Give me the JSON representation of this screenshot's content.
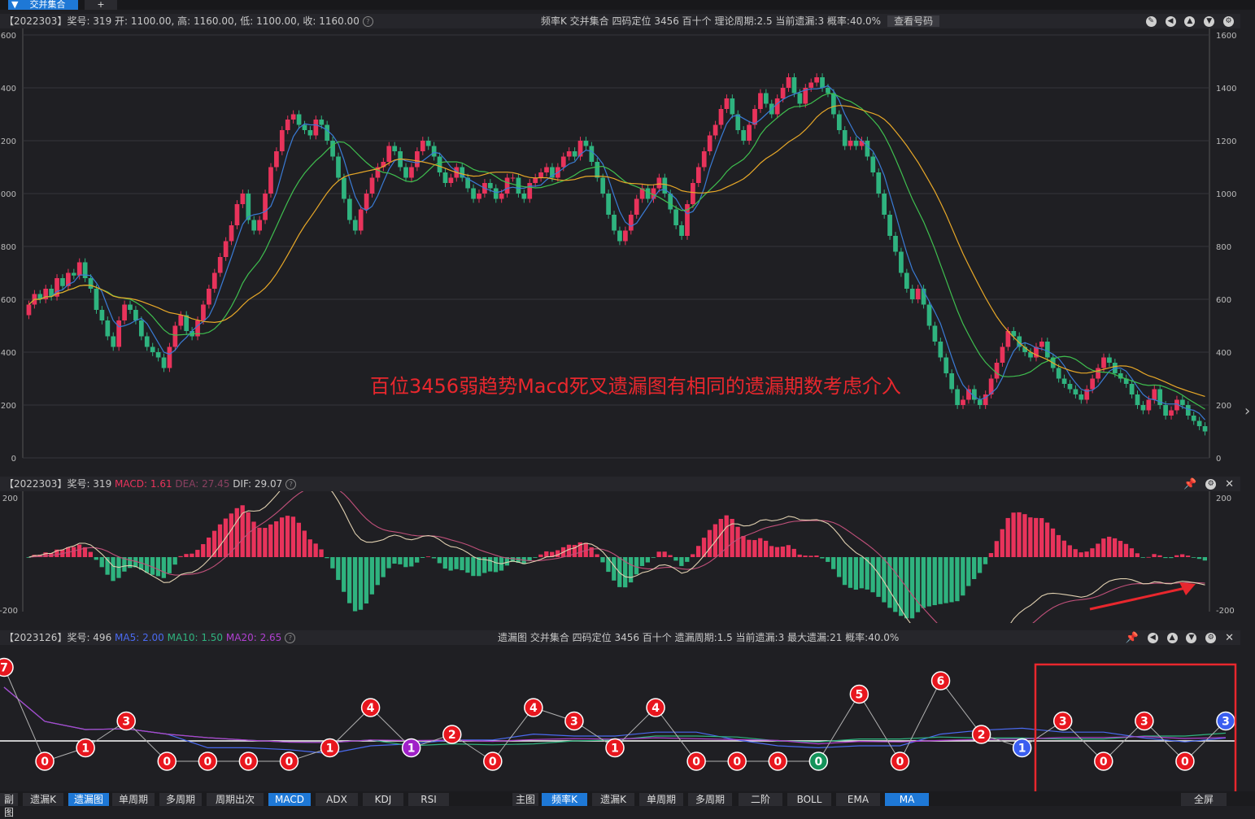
{
  "tabs": {
    "main_label": "交并集合",
    "plus": "+"
  },
  "kline": {
    "header_left": "【2022303】奖号: 319  开: 1100.00, 高: 1160.00, 低: 1100.00, 收: 1160.00",
    "header_center": "频率K  交并集合  四码定位 3456  百十个  理论周期:2.5  当前遗漏:3  概率:40.0%",
    "query_button": "查看号码",
    "y_ticks": [
      "1600",
      "1400",
      "1200",
      "1000",
      "800",
      "600",
      "400",
      "200",
      "0"
    ],
    "annotation": "百位3456弱趋势Macd死叉遗漏图有相同的遗漏期数考虑介入",
    "colors": {
      "up": "#e8335b",
      "down": "#2fb37f",
      "ma5": "#3a7bd5",
      "ma10": "#3fbf4f",
      "ma20": "#e8a828"
    },
    "chart_data": {
      "type": "candlestick",
      "ylim": [
        0,
        1600
      ],
      "close": [
        580,
        620,
        600,
        640,
        610,
        680,
        650,
        700,
        690,
        740,
        680,
        640,
        560,
        520,
        460,
        420,
        520,
        580,
        560,
        520,
        460,
        420,
        400,
        380,
        340,
        420,
        500,
        540,
        480,
        460,
        520,
        580,
        640,
        700,
        760,
        820,
        880,
        960,
        1000,
        900,
        860,
        900,
        1000,
        1100,
        1160,
        1240,
        1280,
        1300,
        1260,
        1240,
        1220,
        1280,
        1260,
        1200,
        1140,
        1060,
        980,
        900,
        860,
        940,
        1000,
        1060,
        1100,
        1120,
        1180,
        1160,
        1100,
        1060,
        1100,
        1160,
        1200,
        1180,
        1140,
        1080,
        1040,
        1060,
        1100,
        1060,
        1020,
        980,
        1000,
        1040,
        1020,
        980,
        1000,
        1060,
        1060,
        1000,
        980,
        1040,
        1060,
        1080,
        1100,
        1060,
        1100,
        1140,
        1160,
        1140,
        1200,
        1180,
        1120,
        1060,
        1000,
        920,
        860,
        820,
        860,
        920,
        980,
        1020,
        980,
        1020,
        1060,
        1000,
        940,
        880,
        840,
        960,
        1040,
        1100,
        1160,
        1220,
        1260,
        1320,
        1360,
        1300,
        1240,
        1200,
        1260,
        1320,
        1380,
        1340,
        1300,
        1360,
        1400,
        1440,
        1380,
        1340,
        1400,
        1420,
        1440,
        1400,
        1380,
        1300,
        1240,
        1180,
        1200,
        1180,
        1200,
        1140,
        1080,
        1000,
        920,
        840,
        780,
        700,
        640,
        600,
        640,
        580,
        500,
        440,
        380,
        320,
        260,
        200,
        220,
        260,
        220,
        200,
        240,
        300,
        360,
        420,
        480,
        460,
        420,
        400,
        380,
        420,
        440,
        380,
        340,
        300,
        280,
        260,
        240,
        220,
        260,
        300,
        340,
        380,
        360,
        320,
        300,
        280,
        240,
        200,
        180,
        220,
        260,
        200,
        160,
        180,
        220,
        200,
        160,
        140,
        120,
        100
      ]
    }
  },
  "macd": {
    "header_left": "【2022303】奖号: 319",
    "macd_label": "MACD: 1.61",
    "dea_label": "DEA: 27.45",
    "dif_label": "DIF: 29.07",
    "y_top": "200",
    "y_bottom": "-200",
    "colors": {
      "macd": "#e8335b",
      "dea": "#c0507a",
      "dif": "#e0d0b0"
    }
  },
  "omit": {
    "header_left": "【2023126】奖号: 496",
    "ma5_label": "MA5: 2.00",
    "ma10_label": "MA10: 1.50",
    "ma20_label": "MA20: 2.65",
    "header_center": "遗漏图  交并集合  四码定位 3456  百十个  遗漏周期:1.5  当前遗漏:3  最大遗漏:21  概率:40.0%",
    "colors": {
      "ma5": "#4a6af0",
      "ma10": "#2fb37f",
      "ma20": "#b040d0"
    },
    "chart_data": {
      "type": "line",
      "values": [
        7,
        0,
        1,
        3,
        0,
        0,
        0,
        0,
        1,
        4,
        1,
        2,
        0,
        4,
        3,
        1,
        4,
        0,
        0,
        0,
        0,
        5,
        0,
        6,
        2,
        1,
        3,
        0,
        3,
        0,
        3
      ]
    }
  },
  "bottombar": {
    "left_items": [
      "副图",
      "遗漏K",
      "遗漏图",
      "单周期",
      "多周期",
      "周期出次",
      "MACD",
      "ADX",
      "KDJ",
      "RSI"
    ],
    "right_items": [
      "主图",
      "频率K",
      "遗漏K",
      "单周期",
      "多周期",
      "二阶",
      "BOLL",
      "EMA",
      "MA"
    ],
    "fullscreen": "全屏"
  }
}
